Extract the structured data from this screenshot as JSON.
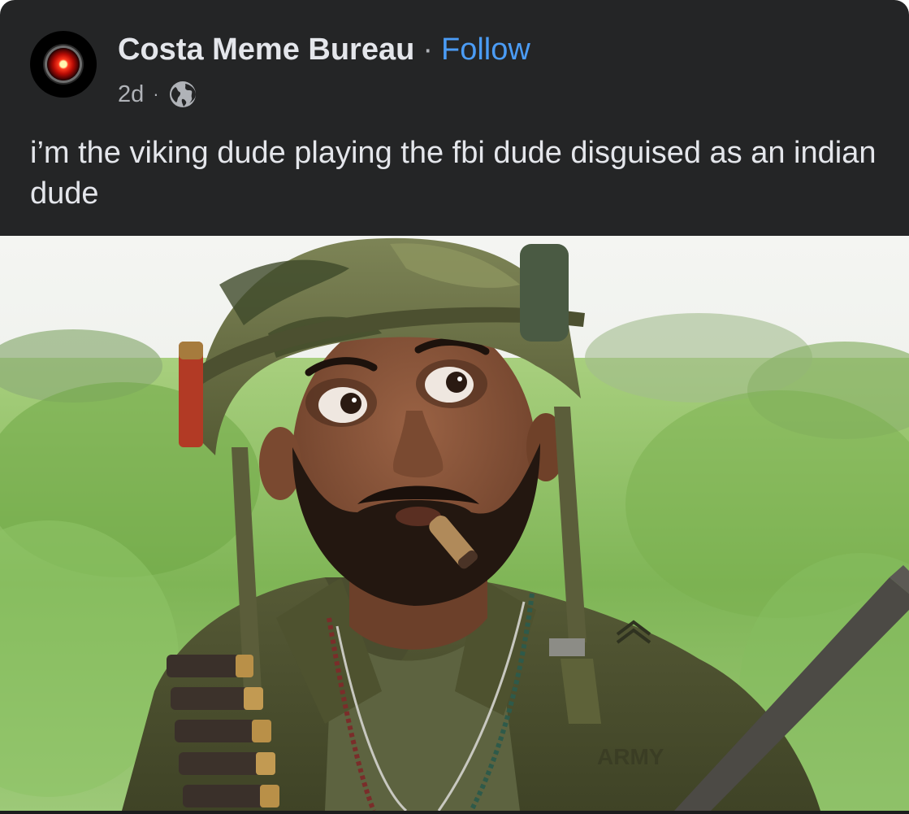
{
  "post": {
    "author_name": "Costa Meme Bureau",
    "separator": "·",
    "follow_label": "Follow",
    "timestamp": "2d",
    "meta_separator": "·",
    "audience_icon": "globe-icon",
    "caption": "i’m the viking dude playing the fbi dude disguised as an indian dude",
    "avatar_icon": "hal-9000-eye-icon"
  },
  "photo": {
    "patch_text": "ARMY"
  },
  "colors": {
    "card_background": "#242526",
    "primary_text": "#e4e6eb",
    "secondary_text": "#b0b3b8",
    "link_blue": "#4b9cf5"
  }
}
